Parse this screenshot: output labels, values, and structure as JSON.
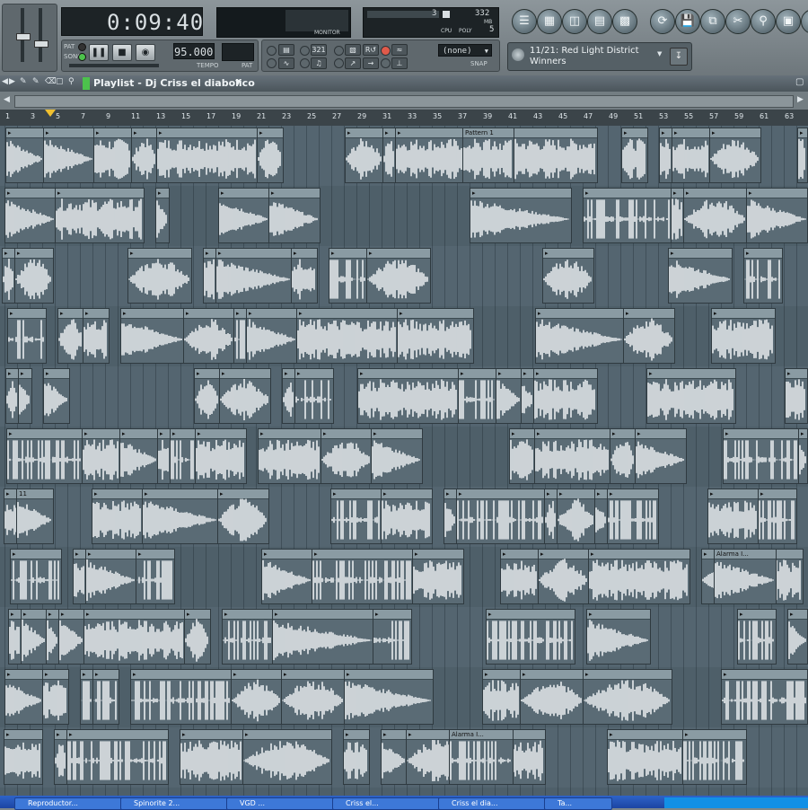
{
  "toolbar": {
    "time": "0:09:40",
    "pat_label": "PAT",
    "song_label": "SONG",
    "tempo": "95.000",
    "tempo_label": "TEMPO",
    "pat_label2": "PAT",
    "monitor_label": "MONITOR",
    "cpu_label": "CPU",
    "poly_label": "POLY",
    "mem_value": "332",
    "mem_unit": "MB",
    "cpu_value": "3",
    "poly_value": "5",
    "snap_value": "(none)",
    "snap_label": "SNAP",
    "song_select": "11/21: Red Light District Winners"
  },
  "playlist": {
    "title": "Playlist - Dj Criss el diabolico"
  },
  "ruler": {
    "ticks": [
      "1",
      "3",
      "5",
      "7",
      "9",
      "11",
      "13",
      "15",
      "17",
      "19",
      "21",
      "23",
      "25",
      "27",
      "29",
      "31",
      "33",
      "35",
      "37",
      "39",
      "41",
      "43",
      "45",
      "47",
      "49",
      "51",
      "53",
      "55",
      "57",
      "59",
      "61",
      "63"
    ]
  },
  "clips": {
    "pattern1": "Pattern 1",
    "label11": "11",
    "alarma1": "Alarma I...",
    "alarma2": "Alarma I..."
  },
  "taskbar": {
    "items": [
      "Reproductor...",
      "Spinorite 2...",
      "VGD ...",
      "Criss el...",
      "Criss el dia...",
      "Ta..."
    ]
  },
  "colors": {
    "accent_green": "#4cc24c",
    "lane": "#546570",
    "waveform": "#e8ecef"
  }
}
